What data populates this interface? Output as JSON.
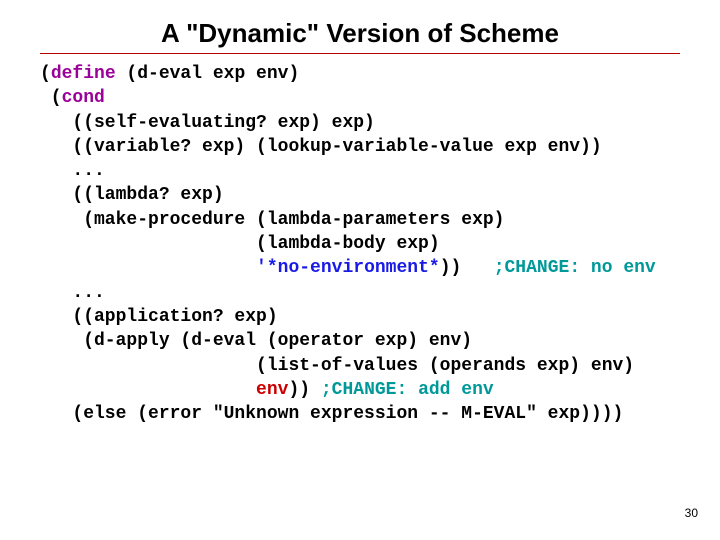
{
  "title": "A \"Dynamic\" Version of Scheme",
  "page_number": "30",
  "code": {
    "l1a": "(",
    "l1b": "define",
    "l1c": " (d-eval exp env)",
    "l2a": " (",
    "l2b": "cond",
    "l3": "   ((self-evaluating? exp) exp)",
    "l4": "   ((variable? exp) (lookup-variable-value exp env))",
    "l5": "   ...",
    "l6": "   ((lambda? exp)",
    "l7": "    (make-procedure (lambda-parameters exp)",
    "l8": "                    (lambda-body exp)",
    "l9a": "                    ",
    "l9b": "'*no-environment*",
    "l9c": "))   ",
    "l9d": ";CHANGE: no env",
    "l10": "   ...",
    "l11": "   ((application? exp)",
    "l12": "    (d-apply (d-eval (operator exp) env)",
    "l13": "                    (list-of-values (operands exp) env)",
    "l14a": "                    ",
    "l14b": "env",
    "l14c": ")) ",
    "l14d": ";CHANGE: add env",
    "l15": "   (else (error \"Unknown expression -- M-EVAL\" exp))))"
  }
}
